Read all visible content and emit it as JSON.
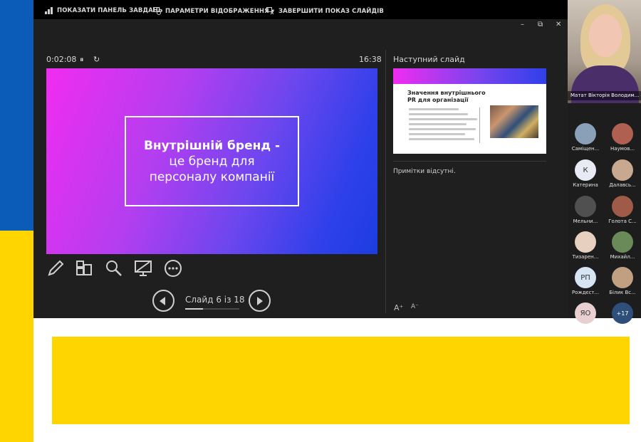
{
  "toolbar": {
    "show_taskbar": "ПОКАЗАТИ ПАНЕЛЬ ЗАВДАНЬ",
    "display_settings": "ПАРАМЕТРИ ВІДОБРАЖЕННЯ ▾",
    "end_show": "ЗАВЕРШИТИ ПОКАЗ СЛАЙДІВ"
  },
  "window_controls": {
    "minimize": "–",
    "restore": "⧉",
    "close": "✕"
  },
  "timer": {
    "elapsed": "0:02:08",
    "pause": "⏸",
    "reset": "↻",
    "clock": "16:38"
  },
  "current_slide": {
    "title": "Внутрішній бренд -",
    "line2": "це бренд для",
    "line3": "персоналу компанії"
  },
  "navigation": {
    "label": "Слайд 6 із 18",
    "progress": 0.333
  },
  "next_slide": {
    "label": "Наступний слайд",
    "title": "Значення внутрішнього PR для організації",
    "bullet_count_hint": 7
  },
  "notes": {
    "text": "Примітки відсутні."
  },
  "font_controls": {
    "increase": "A⁺",
    "decrease": "A⁻"
  },
  "webcam": {
    "name": "Матат Вікторія Володим..."
  },
  "participants": [
    {
      "name": "Саміщен...",
      "initials": "",
      "color": "#8aa0b8"
    },
    {
      "name": "Наумов...",
      "initials": "",
      "color": "#b06050"
    },
    {
      "name": "Катерина",
      "initials": "К",
      "color": "#e8eaf4"
    },
    {
      "name": "Далавсь...",
      "initials": "",
      "color": "#c9a890"
    },
    {
      "name": "Мельни...",
      "initials": "",
      "color": "#505050"
    },
    {
      "name": "Голота С...",
      "initials": "",
      "color": "#a05a48"
    },
    {
      "name": "Тизарен...",
      "initials": "",
      "color": "#e8d0c0"
    },
    {
      "name": "Михайл...",
      "initials": "",
      "color": "#6a8a5a"
    },
    {
      "name": "Рождєст...",
      "initials": "РП",
      "color": "#d7e4f4"
    },
    {
      "name": "Білик Вс...",
      "initials": "",
      "color": "#c0a080"
    },
    {
      "name": "",
      "initials": "ЯО",
      "color": "#e9cfcf"
    },
    {
      "name": "",
      "initials": "+17",
      "color": "#2e4f7a"
    }
  ],
  "colors": {
    "flag_blue": "#0a5cb8",
    "flag_yellow": "#ffd500",
    "presenter_bg": "#1f1f1f"
  }
}
